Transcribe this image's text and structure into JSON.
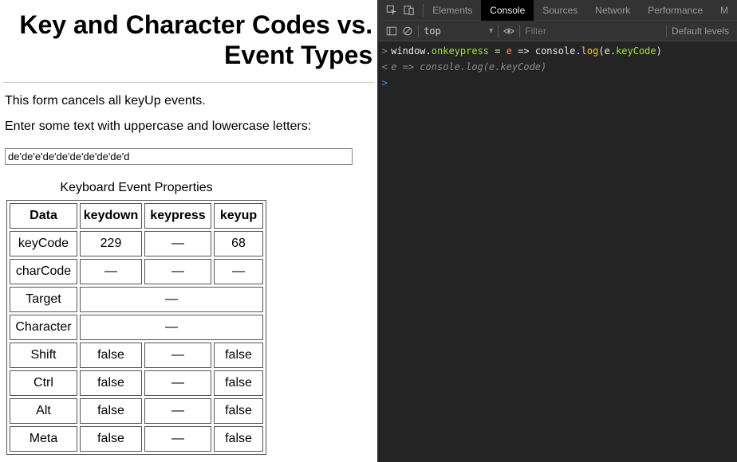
{
  "page": {
    "title": "Key and Character Codes vs. Event Types",
    "p1": "This form cancels all keyUp events.",
    "p2": "Enter some text with uppercase and lowercase letters:",
    "input_value": "de'de'e'de'de'de'de'de'de'd"
  },
  "table": {
    "caption": "Keyboard Event Properties",
    "headers": [
      "Data",
      "keydown",
      "keypress",
      "keyup"
    ],
    "rows": [
      {
        "label": "keyCode",
        "cells": [
          "229",
          "—",
          "68"
        ]
      },
      {
        "label": "charCode",
        "cells": [
          "—",
          "—",
          "—"
        ]
      },
      {
        "label": "Target",
        "span": "—"
      },
      {
        "label": "Character",
        "span": "—"
      },
      {
        "label": "Shift",
        "cells": [
          "false",
          "—",
          "false"
        ]
      },
      {
        "label": "Ctrl",
        "cells": [
          "false",
          "—",
          "false"
        ]
      },
      {
        "label": "Alt",
        "cells": [
          "false",
          "—",
          "false"
        ]
      },
      {
        "label": "Meta",
        "cells": [
          "false",
          "—",
          "false"
        ]
      }
    ]
  },
  "devtools": {
    "tabs": [
      "Elements",
      "Console",
      "Sources",
      "Network",
      "Performance",
      "M"
    ],
    "active_tab": 1,
    "context": "top",
    "filter_placeholder": "Filter",
    "levels_label": "Default levels",
    "console_lines": [
      {
        "gutter": ">",
        "tokens": [
          {
            "t": "window",
            "c": "tok-default"
          },
          {
            "t": ".",
            "c": "tok-punc"
          },
          {
            "t": "onkeypress",
            "c": "tok-prop"
          },
          {
            "t": " = ",
            "c": "tok-punc"
          },
          {
            "t": "e",
            "c": "tok-param"
          },
          {
            "t": " => ",
            "c": "tok-punc"
          },
          {
            "t": "console",
            "c": "tok-default"
          },
          {
            "t": ".",
            "c": "tok-punc"
          },
          {
            "t": "log",
            "c": "tok-func"
          },
          {
            "t": "(",
            "c": "tok-punc"
          },
          {
            "t": "e",
            "c": "tok-default"
          },
          {
            "t": ".",
            "c": "tok-punc"
          },
          {
            "t": "keyCode",
            "c": "tok-prop"
          },
          {
            "t": ")",
            "c": "tok-punc"
          }
        ]
      },
      {
        "gutter": "<",
        "tokens": [
          {
            "t": "e => console.log(e.keyCode)",
            "c": "tok-dim"
          }
        ]
      },
      {
        "gutter": ">",
        "gutter_class": "dt-prompt",
        "tokens": []
      }
    ]
  }
}
